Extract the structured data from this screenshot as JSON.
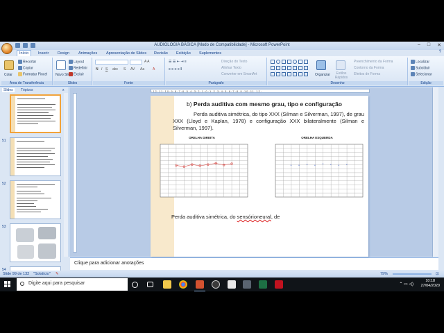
{
  "window": {
    "title": "AUDIOLOGIA BÁSICA [Modo de Compatibilidade] - Microsoft PowerPoint",
    "help": "?"
  },
  "ribbon_tabs": [
    "Início",
    "Inserir",
    "Design",
    "Animações",
    "Apresentação de Slides",
    "Revisão",
    "Exibição",
    "Suplementos"
  ],
  "ribbon": {
    "clipboard": {
      "paste": "Colar",
      "cut": "Recortar",
      "copy": "Copiar",
      "format_painter": "Formatar Pincel",
      "label": "Área de Transferência"
    },
    "slides": {
      "new_slide": "Novo Slide",
      "layout": "Layout",
      "reset": "Redefinir",
      "delete": "Excluir",
      "label": "Slides"
    },
    "font": {
      "label": "Fonte"
    },
    "paragraph": {
      "text_direction": "Direção do Texto",
      "align_text": "Alinhar Texto",
      "smartart": "Converter em SmartArt",
      "label": "Parágrafo"
    },
    "drawing": {
      "arrange": "Organizar",
      "quick_styles": "Estilos Rápidos",
      "fill": "Preenchimento da Forma",
      "outline": "Contorno da Forma",
      "effects": "Efeitos de Forma",
      "label": "Desenho"
    },
    "editing": {
      "find": "Localizar",
      "replace": "Substituir",
      "select": "Selecionar",
      "label": "Edição"
    }
  },
  "left_panel": {
    "tabs": [
      "Slides",
      "Tópicos"
    ],
    "close": "x",
    "thumbnails": [
      {
        "number": "",
        "selected": true
      },
      {
        "number": "51",
        "selected": false
      },
      {
        "number": "52",
        "selected": false
      },
      {
        "number": "53",
        "selected": false
      },
      {
        "number": "54",
        "selected": false
      }
    ]
  },
  "slide": {
    "heading_prefix": "b) ",
    "heading": "Perda auditiva com mesmo grau, tipo e configuração",
    "paragraph": "Perda auditiva simétrica, do tipo XXX (Silman e Silverman, 1997), de grau XXX (Lloyd e Kaplan, 1978) e configuração XXX bilateralmente (Silman e Silverman, 1997).",
    "bottom_prefix": "Perda auditiva simétrica, do ",
    "bottom_spell": "sensórioneural",
    "bottom_suffix": ", de",
    "audiogram_right_title": "ORELHA DIREITA",
    "audiogram_left_title": "ORELHA ESQUERDA"
  },
  "notes_placeholder": "Clique para adicionar anotações",
  "status": {
    "slide": "Slide 99 de 132",
    "theme": "\"Solstício\"",
    "zoom": "79%"
  },
  "taskbar": {
    "search_placeholder": "Digite aqui para pesquisar",
    "time": "10:18",
    "date": "27/04/2020"
  },
  "colors": {
    "ribbon_bg": "#dbe6f4",
    "accent": "#15428b",
    "slide_stripe": "#f8e9cc",
    "right_ear": "#d9534f",
    "left_ear": "#3b5cc4",
    "taskbar": "#101418"
  }
}
